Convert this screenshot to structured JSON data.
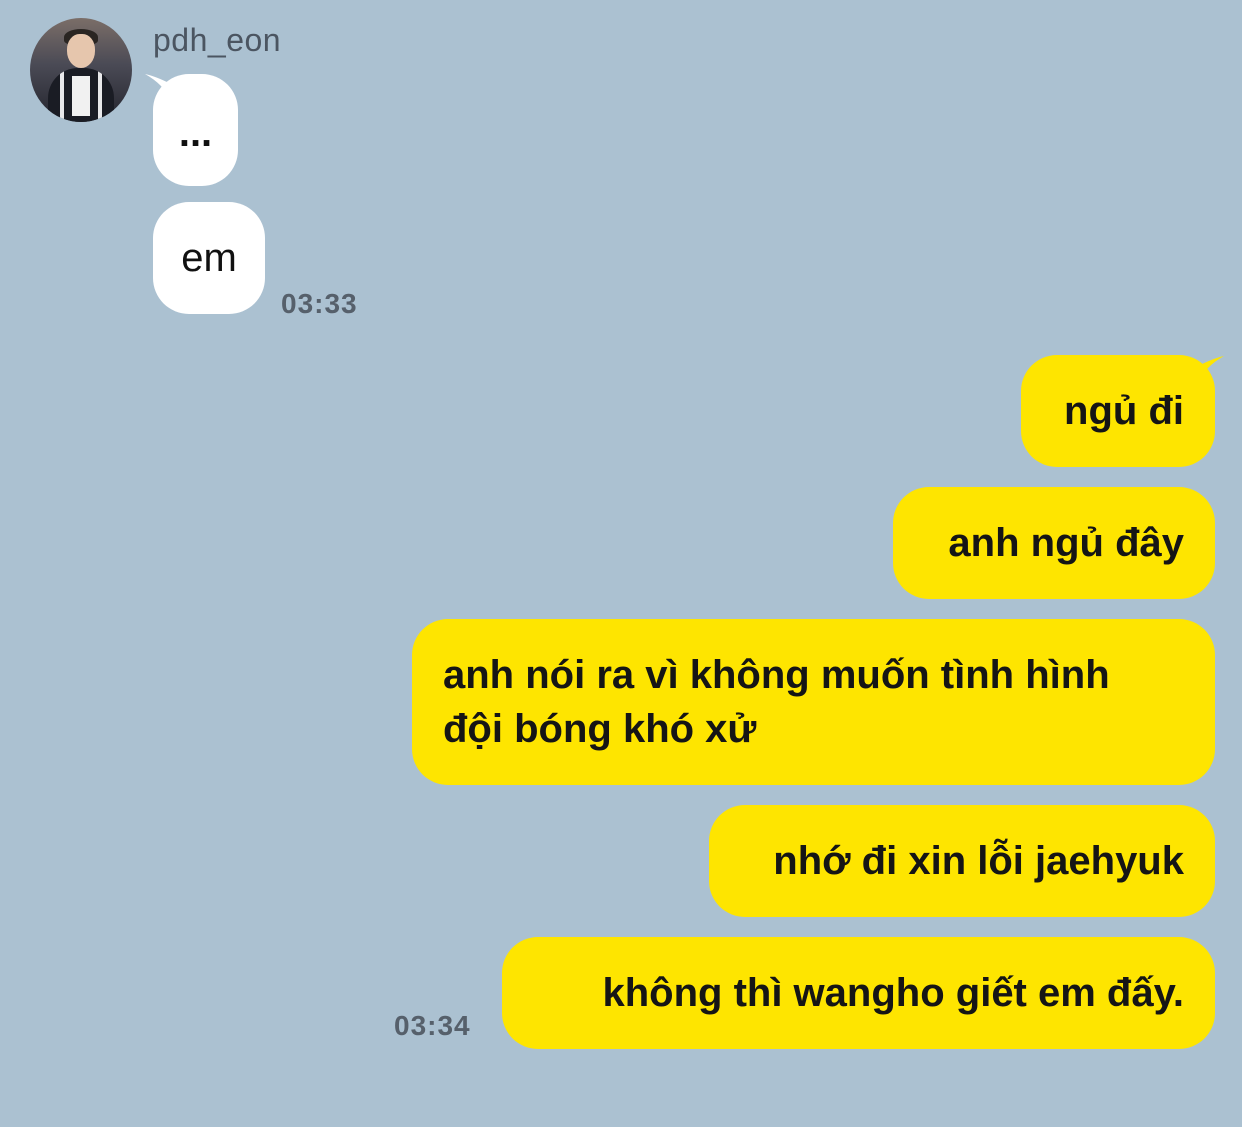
{
  "sender": {
    "name": "pdh_eon"
  },
  "messages_in": [
    {
      "text": "..."
    },
    {
      "text": "em"
    }
  ],
  "time_in": "03:33",
  "messages_out": [
    {
      "text": "ngủ đi"
    },
    {
      "text": "anh ngủ đây"
    },
    {
      "line1": "anh nói ra vì không muốn tình hình",
      "line2": "đội bóng khó xử"
    },
    {
      "text": "nhớ đi xin lỗi jaehyuk"
    },
    {
      "text": "không thì wangho giết em đấy."
    }
  ],
  "time_out": "03:34",
  "colors": {
    "background": "#abc1d1",
    "incoming_bubble": "#ffffff",
    "outgoing_bubble": "#fee500",
    "timestamp": "#56606b"
  }
}
